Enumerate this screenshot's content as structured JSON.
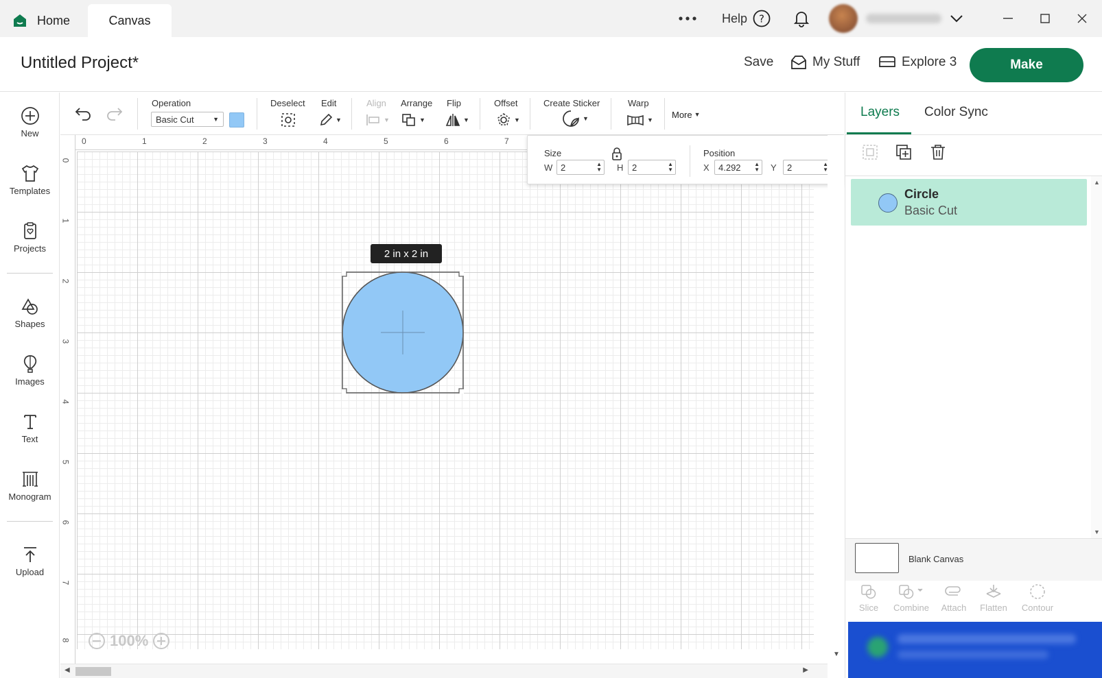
{
  "tabs": {
    "home": "Home",
    "canvas": "Canvas"
  },
  "window": {
    "help_label": "Help",
    "user_name_blurred": ""
  },
  "header": {
    "project_title": "Untitled Project*",
    "save_label": "Save",
    "my_stuff_label": "My Stuff",
    "machine_label": "Explore 3",
    "make_label": "Make"
  },
  "sidebar": {
    "items": [
      {
        "label": "New",
        "icon": "plus-circle-icon"
      },
      {
        "label": "Templates",
        "icon": "tshirt-icon"
      },
      {
        "label": "Projects",
        "icon": "clipboard-heart-icon"
      },
      {
        "label": "Shapes",
        "icon": "shapes-icon"
      },
      {
        "label": "Images",
        "icon": "balloon-icon"
      },
      {
        "label": "Text",
        "icon": "text-icon"
      },
      {
        "label": "Monogram",
        "icon": "monogram-icon"
      },
      {
        "label": "Upload",
        "icon": "upload-icon"
      }
    ]
  },
  "toolbar": {
    "operation_label": "Operation",
    "operation_value": "Basic Cut",
    "operation_color": "#92c8f6",
    "deselect_label": "Deselect",
    "edit_label": "Edit",
    "align_label": "Align",
    "arrange_label": "Arrange",
    "flip_label": "Flip",
    "offset_label": "Offset",
    "create_sticker_label": "Create Sticker",
    "warp_label": "Warp",
    "more_label": "More"
  },
  "size_panel": {
    "size_label": "Size",
    "w_label": "W",
    "w_value": "2",
    "h_label": "H",
    "h_value": "2",
    "position_label": "Position",
    "x_label": "X",
    "x_value": "4.292",
    "y_label": "Y",
    "y_value": "2"
  },
  "canvas": {
    "ruler_top": [
      "0",
      "1",
      "2",
      "3",
      "4",
      "5",
      "6",
      "7"
    ],
    "ruler_left": [
      "0",
      "1",
      "2",
      "3",
      "4",
      "5",
      "6",
      "7",
      "8"
    ],
    "selection_tooltip": "2  in x 2  in",
    "zoom_level": "100%",
    "shape_fill": "#92c8f6"
  },
  "right_panel": {
    "tab_layers": "Layers",
    "tab_color_sync": "Color Sync",
    "layers": [
      {
        "name": "Circle",
        "operation": "Basic Cut",
        "color": "#92c8f6"
      }
    ],
    "blank_canvas_label": "Blank Canvas",
    "bottom_tools": [
      "Slice",
      "Combine",
      "Attach",
      "Flatten",
      "Contour"
    ]
  },
  "colors": {
    "brand": "#0f7b4f",
    "layer_selected": "#b9ead8"
  }
}
